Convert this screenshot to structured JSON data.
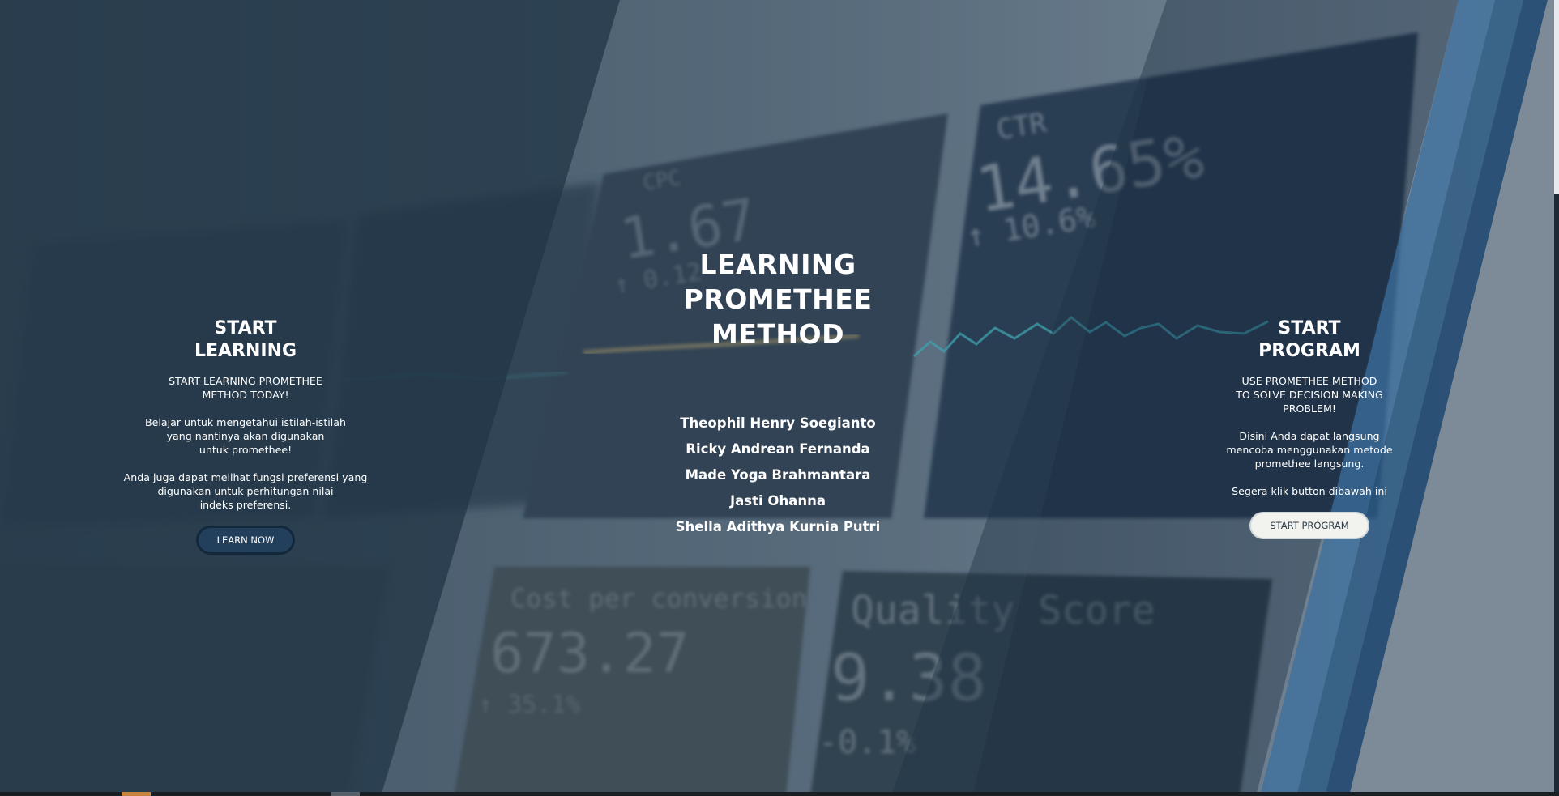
{
  "hero": {
    "title": "LEARNING\nPROMETHEE\nMETHOD",
    "authors": [
      "Theophil Henry Soegianto",
      "Ricky Andrean Fernanda",
      "Made Yoga Brahmantara",
      "Jasti Ohanna",
      "Shella Adithya Kurnia Putri"
    ]
  },
  "background": {
    "tiles": [
      {
        "label": "CTR",
        "value": "14.65%",
        "sub": "↑ 10.6%"
      },
      {
        "label": "CPC",
        "value": "1.67",
        "sub": "↑ 0.12"
      },
      {
        "label": "Cost per conversion",
        "value": "673.27",
        "sub": "↑ 35.1%"
      },
      {
        "label": "Quality Score",
        "value": "9.38",
        "sub": "-0.1%"
      }
    ],
    "colors": {
      "overlay": "#2d3f4f",
      "teal_line": "#3aa6b3",
      "band_blue": "#2e5e8c"
    }
  },
  "left": {
    "title": "START\nLEARNING",
    "subtitle": "START LEARNING PROMETHEE\nMETHOD TODAY!",
    "text1": "Belajar untuk mengetahui istilah-istilah\nyang nantinya akan digunakan\nuntuk promethee!",
    "text2": "Anda juga dapat melihat fungsi preferensi yang\ndigunakan untuk perhitungan nilai\nindeks preferensi.",
    "button": "LEARN NOW"
  },
  "right": {
    "title": "START\nPROGRAM",
    "subtitle": "USE PROMETHEE METHOD\nTO SOLVE DECISION MAKING\nPROBLEM!",
    "text1": "Disini Anda dapat langsung\nmencoba menggunakan metode\npromethee langsung.",
    "text2": "Segera klik button dibawah ini",
    "button": "START PROGRAM"
  }
}
